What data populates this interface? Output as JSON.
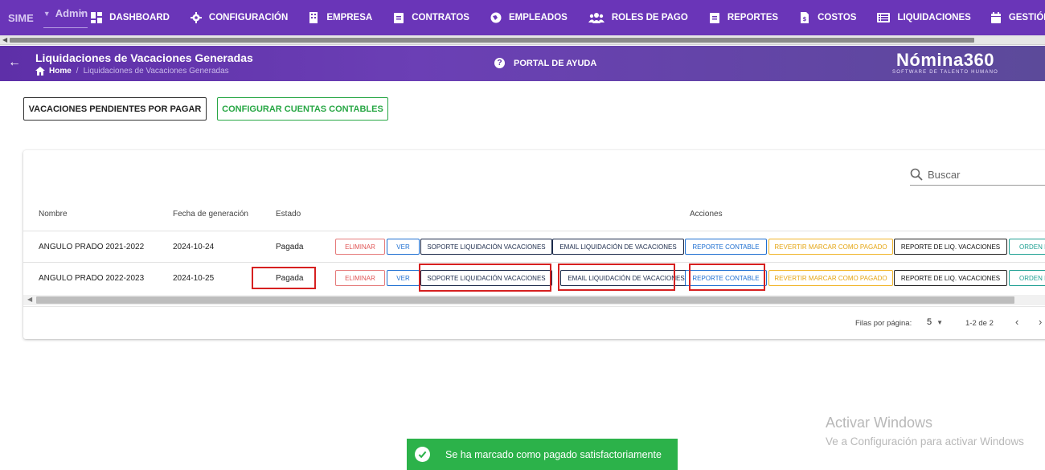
{
  "nav": {
    "brand": "SIME",
    "user": "Admin",
    "items": [
      {
        "label": "DASHBOARD",
        "icon": "dashboard-icon"
      },
      {
        "label": "CONFIGURACIÓN",
        "icon": "gear-icon"
      },
      {
        "label": "EMPRESA",
        "icon": "building-icon"
      },
      {
        "label": "CONTRATOS",
        "icon": "clipboard-icon"
      },
      {
        "label": "EMPLEADOS",
        "icon": "globe-icon"
      },
      {
        "label": "ROLES DE PAGO",
        "icon": "users-icon"
      },
      {
        "label": "REPORTES",
        "icon": "clipboard-icon"
      },
      {
        "label": "COSTOS",
        "icon": "file-dollar-icon"
      },
      {
        "label": "LIQUIDACIONES",
        "icon": "list-icon"
      },
      {
        "label": "GESTIÓN DE T",
        "icon": "calendar-icon"
      }
    ]
  },
  "header": {
    "title": "Liquidaciones de Vacaciones Generadas",
    "breadcrumb_home": "Home",
    "breadcrumb_sep": "/",
    "breadcrumb_current": "Liquidaciones de Vacaciones Generadas",
    "help": "PORTAL DE AYUDA",
    "logo_name": "Nómina360",
    "logo_tag": "SOFTWARE DE TALENTO HUMANO"
  },
  "actions": {
    "pending": "VACACIONES PENDIENTES POR PAGAR",
    "configure": "CONFIGURAR CUENTAS CONTABLES"
  },
  "table": {
    "search_placeholder": "Buscar",
    "columns": {
      "name": "Nombre",
      "date": "Fecha de generación",
      "status": "Estado",
      "actions": "Acciones"
    },
    "buttons": {
      "delete": "ELIMINAR",
      "view": "VER",
      "support": "SOPORTE LIQUIDACIÓN VACACIONES",
      "email": "EMAIL LIQUIDACIÓN DE VACACIONES",
      "accounting": "REPORTE CONTABLE",
      "revert": "REVERTIR MARCAR COMO PAGADO",
      "liq_report": "REPORTE DE LIQ. VACACIONES",
      "order": "ORDEN D"
    },
    "rows": [
      {
        "name": "ANGULO PRADO 2021-2022",
        "date": "2024-10-24",
        "status": "Pagada"
      },
      {
        "name": "ANGULO PRADO 2022-2023",
        "date": "2024-10-25",
        "status": "Pagada"
      }
    ],
    "pagination": {
      "rows_per_page_label": "Filas por página:",
      "rows_per_page": "5",
      "range": "1-2 de 2"
    }
  },
  "watermark": {
    "line1": "Activar Windows",
    "line2": "Ve a Configuración para activar Windows"
  },
  "toast": {
    "message": "Se ha marcado como pagado satisfactoriamente"
  },
  "colors": {
    "nav": "#6a35b8",
    "header": "#5e2fa8",
    "success": "#2cb24a",
    "highlight": "#d62020"
  }
}
